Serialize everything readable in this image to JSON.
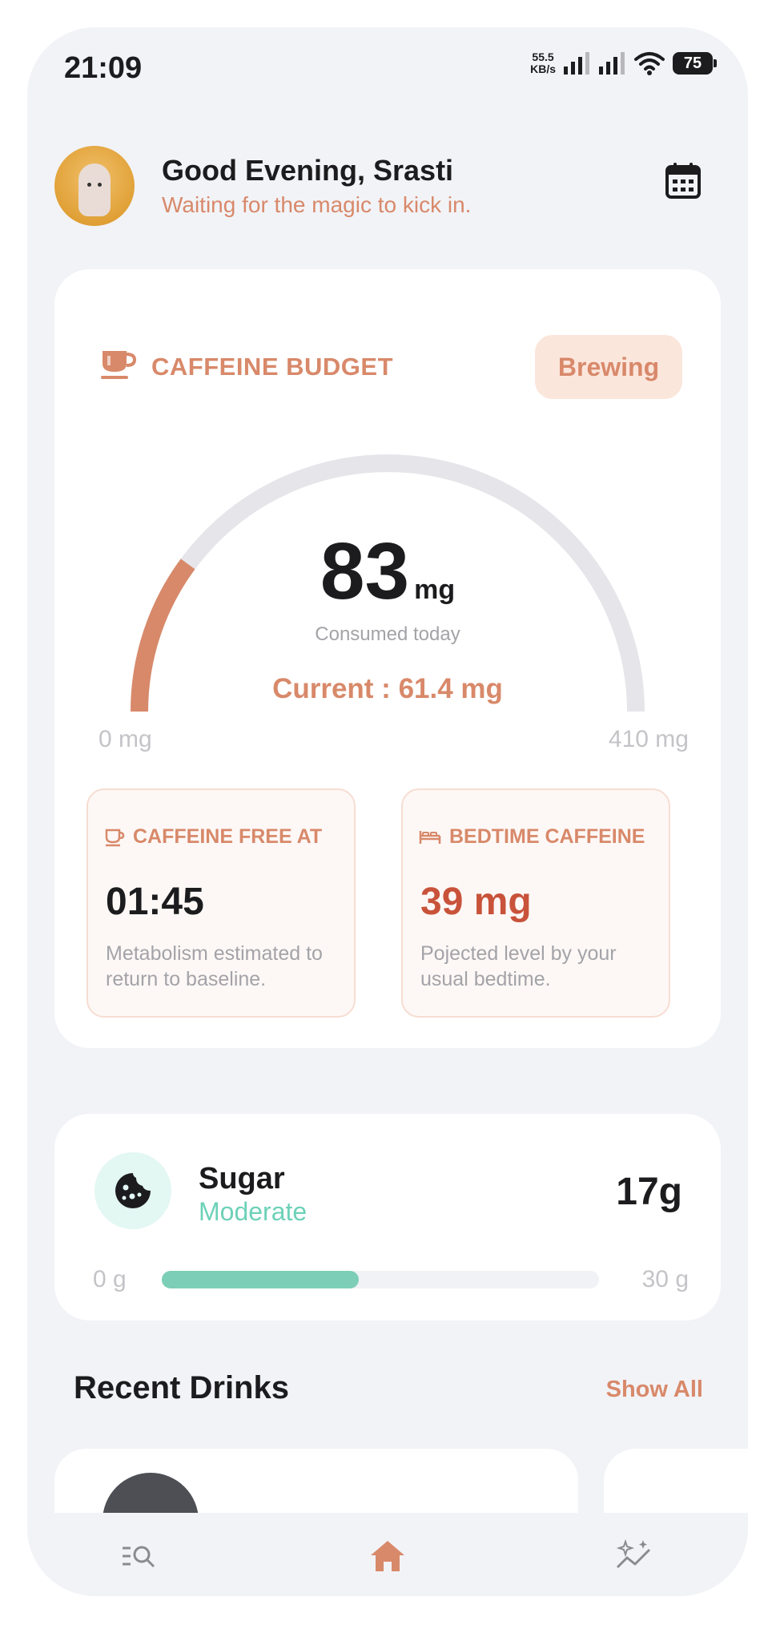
{
  "status_bar": {
    "time": "21:09",
    "net_speed_value": "55.5",
    "net_speed_unit": "KB/s",
    "battery": "75"
  },
  "header": {
    "greeting": "Good Evening, Srasti",
    "subtitle": "Waiting for the magic to kick in.",
    "calendar_icon": "calendar-icon"
  },
  "caffeine": {
    "title": "CAFFEINE BUDGET",
    "status_badge": "Brewing",
    "consumed_value": "83",
    "consumed_unit": "mg",
    "consumed_label": "Consumed today",
    "current_label": "Current : 61.4 mg",
    "range_min": "0 mg",
    "range_max": "410 mg",
    "consumed_mg": 83,
    "max_mg": 410,
    "gauge_fill_color": "#d8896a",
    "gauge_track_color": "#e5e5ea",
    "free_at": {
      "label": "CAFFEINE FREE AT",
      "value": "01:45",
      "description": "Metabolism estimated to return to baseline."
    },
    "bedtime": {
      "label": "BEDTIME CAFFEINE",
      "value": "39 mg",
      "description": "Pojected level by your usual bedtime."
    }
  },
  "sugar": {
    "title": "Sugar",
    "level": "Moderate",
    "amount": "17g",
    "range_min": "0 g",
    "range_max": "30 g",
    "progress_fraction": 0.45,
    "bar_color": "#7ccfb6"
  },
  "recent": {
    "title": "Recent Drinks",
    "show_all": "Show All"
  },
  "nav": {
    "items": [
      "search-list-icon",
      "home-icon",
      "sparkle-trend-icon"
    ],
    "active": "home-icon",
    "accent": "#d8896a"
  }
}
